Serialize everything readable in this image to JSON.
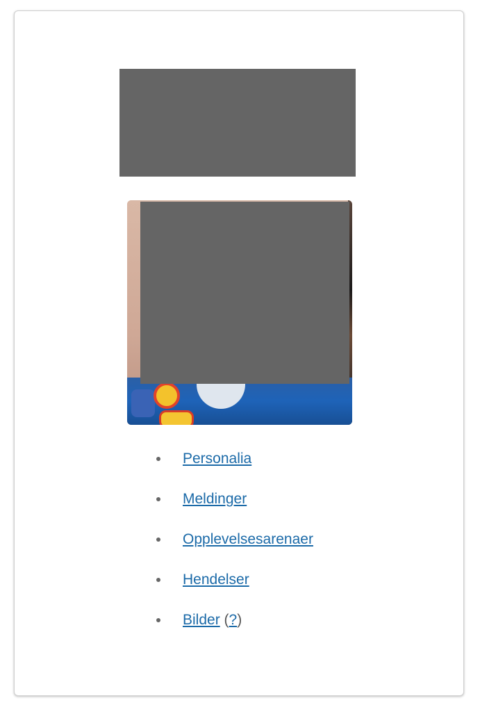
{
  "nav": {
    "items": [
      {
        "label": "Personalia"
      },
      {
        "label": "Meldinger"
      },
      {
        "label": "Opplevelsesarenaer"
      },
      {
        "label": "Hendelser"
      },
      {
        "label": "Bilder",
        "help_label": "?",
        "help_open": "(",
        "help_close": ")"
      }
    ]
  },
  "colors": {
    "link": "#1b6aa8",
    "redaction": "#656565",
    "bullet": "#666666"
  }
}
